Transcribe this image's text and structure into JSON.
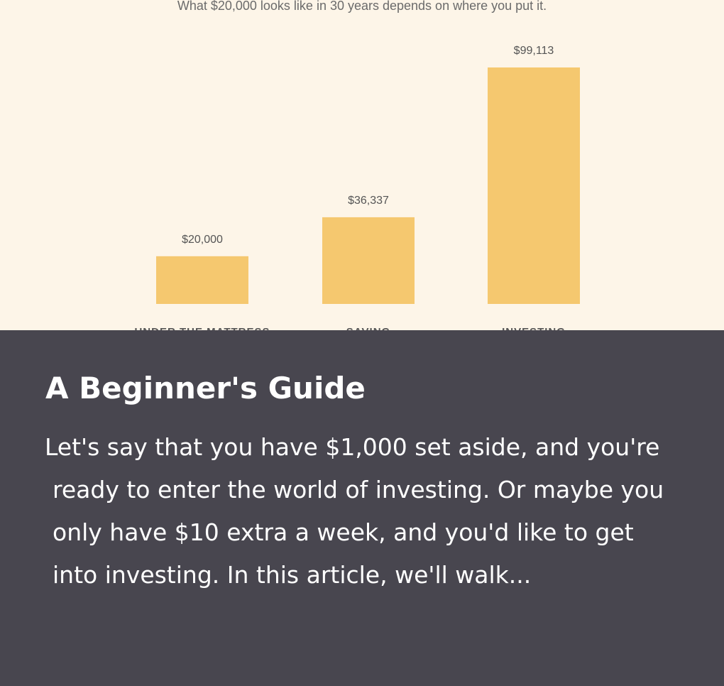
{
  "chart_data": {
    "type": "bar",
    "subtitle": "What $20,000 looks like in 30 years depends on where you put it.",
    "categories": [
      "UNDER THE MATTRESS",
      "SAVING",
      "INVESTING"
    ],
    "values": [
      20000,
      36337,
      99113
    ],
    "value_labels": [
      "$20,000",
      "$36,337",
      "$99,113"
    ],
    "bar_color": "#f5c86f",
    "background_color": "#fdf5e8",
    "ylim": [
      0,
      99113
    ]
  },
  "article": {
    "title": "A Beginner's Guide",
    "excerpt_lines": [
      "Let's say that you have $1,000 set aside, and you're",
      "ready to enter the world of investing. Or maybe you",
      "only have $10 extra a week, and you'd like to get",
      "into investing. In this article, we'll walk..."
    ]
  },
  "colors": {
    "card_background": "#48464f",
    "text_light": "#ffffff"
  }
}
